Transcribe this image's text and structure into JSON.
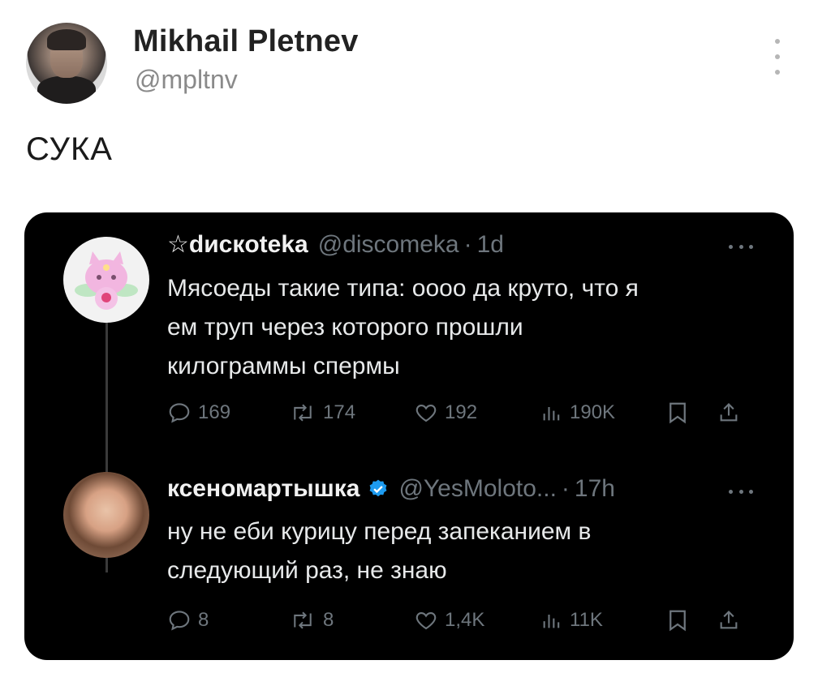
{
  "post": {
    "author_name": "Mikhail Pletnev",
    "author_handle": "@mpltnv",
    "text": "СУКА"
  },
  "quoted": [
    {
      "name": "☆dиcкoteka",
      "handle": "@discomeka",
      "time": "1d",
      "text_lines": [
        "Мясоеды такие типа: оооо да круто, что я",
        "ем труп через которого прошли",
        "килограммы спермы"
      ],
      "stats": {
        "replies": "169",
        "reposts": "174",
        "likes": "192",
        "views": "190K"
      }
    },
    {
      "name": "ксеномартышка",
      "handle": "@YesMoloto...",
      "time": "17h",
      "verified": true,
      "text_lines": [
        "ну не еби курицу перед запеканием в",
        "следующий раз, не знаю"
      ],
      "stats": {
        "replies": "8",
        "reposts": "8",
        "likes": "1,4K",
        "views": "11K"
      }
    }
  ],
  "icons": {
    "reply": "reply-icon",
    "repost": "repost-icon",
    "like": "heart-icon",
    "views": "views-icon",
    "bookmark": "bookmark-icon",
    "share": "share-icon",
    "more": "more-icon",
    "verified": "verified-badge-icon"
  },
  "colors": {
    "card_bg": "#000000",
    "muted": "#6e767d",
    "verified": "#1d9bf0"
  }
}
